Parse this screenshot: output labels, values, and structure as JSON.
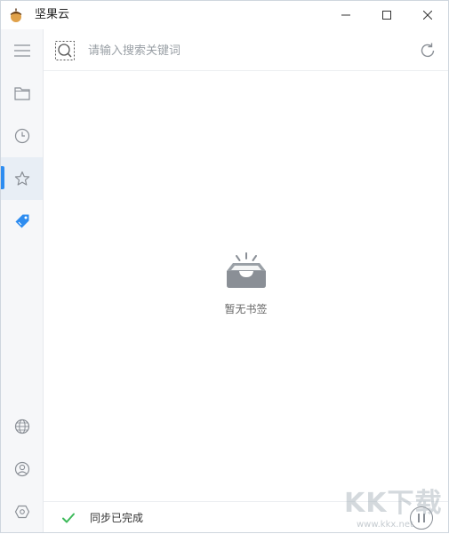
{
  "window": {
    "title": "坚果云",
    "controls": {
      "minimize": "minimize",
      "maximize": "maximize",
      "close": "close"
    }
  },
  "sidebar": {
    "items": [
      {
        "id": "menu",
        "icon": "hamburger-menu-icon"
      },
      {
        "id": "files",
        "icon": "folder-icon"
      },
      {
        "id": "recent",
        "icon": "clock-icon"
      },
      {
        "id": "bookmarks",
        "icon": "star-icon",
        "active": true
      },
      {
        "id": "tags",
        "icon": "tag-icon"
      }
    ],
    "bottom_items": [
      {
        "id": "web",
        "icon": "globe-icon"
      },
      {
        "id": "account",
        "icon": "user-icon"
      },
      {
        "id": "settings",
        "icon": "hexagon-settings-icon"
      }
    ]
  },
  "search": {
    "placeholder": "请输入搜索关键词",
    "value": ""
  },
  "empty_state": {
    "message": "暂无书签",
    "icon": "empty-inbox-icon"
  },
  "status": {
    "text": "同步已完成",
    "icon": "check-icon"
  },
  "watermark": {
    "big": "KK下载",
    "small": "www.kkx.net"
  },
  "colors": {
    "accent": "#2d8cf0",
    "sidebar_bg": "#f6f7f9",
    "check_green": "#3dba5a",
    "icon_gray": "#8a8f96"
  }
}
